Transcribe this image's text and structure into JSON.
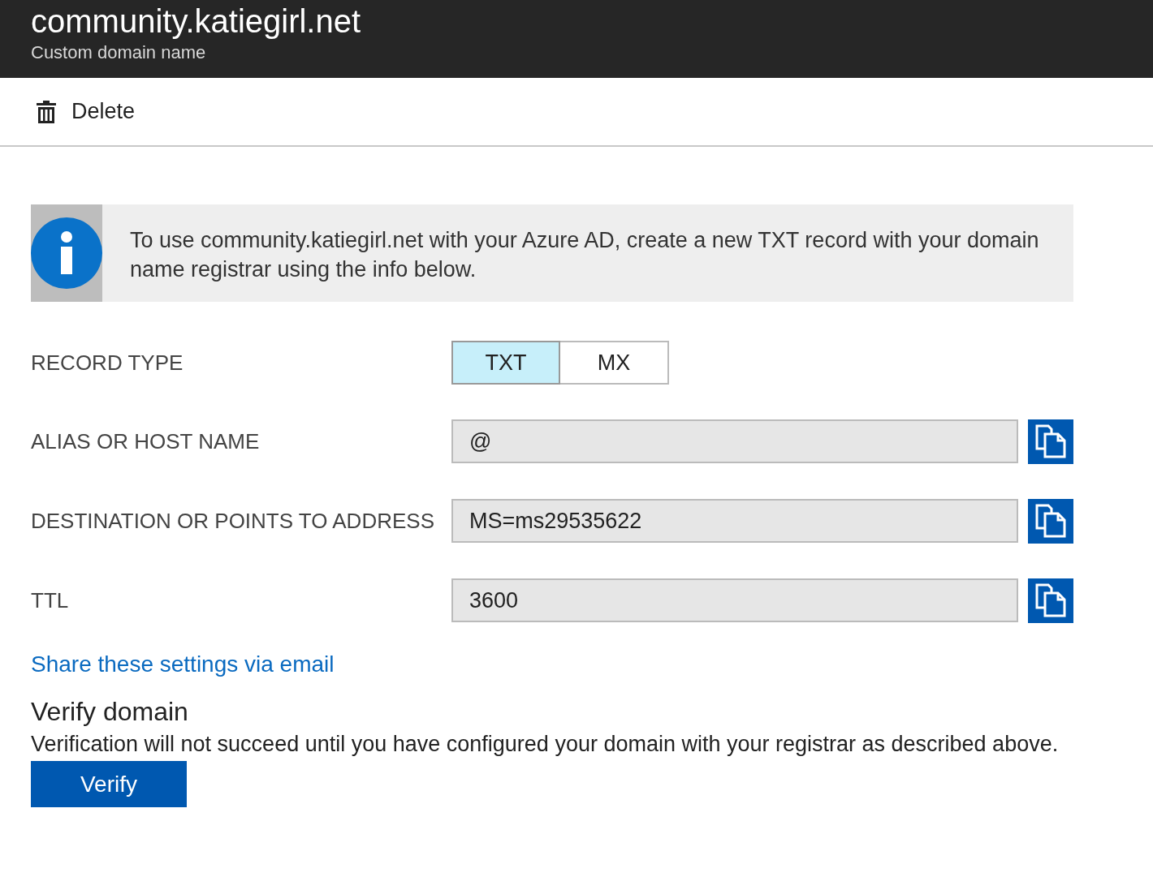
{
  "header": {
    "title": "community.katiegirl.net",
    "subtitle": "Custom domain name"
  },
  "toolbar": [
    {
      "label": "Delete"
    }
  ],
  "info": {
    "text": "To use community.katiegirl.net with your Azure AD, create a new TXT record with your domain name registrar using the info below."
  },
  "record_type": {
    "label": "RECORD TYPE",
    "options": [
      {
        "label": "TXT",
        "selected": true
      },
      {
        "label": "MX",
        "selected": false
      }
    ]
  },
  "fields": [
    {
      "label": "ALIAS OR HOST NAME",
      "value": "@"
    },
    {
      "label": "DESTINATION OR POINTS TO ADDRESS",
      "value": "MS=ms29535622"
    },
    {
      "label": "TTL",
      "value": "3600"
    }
  ],
  "share_link": "Share these settings via email",
  "verify": {
    "title": "Verify domain",
    "description": "Verification will not succeed until you have configured your domain with your registrar as described above.",
    "button": "Verify"
  }
}
